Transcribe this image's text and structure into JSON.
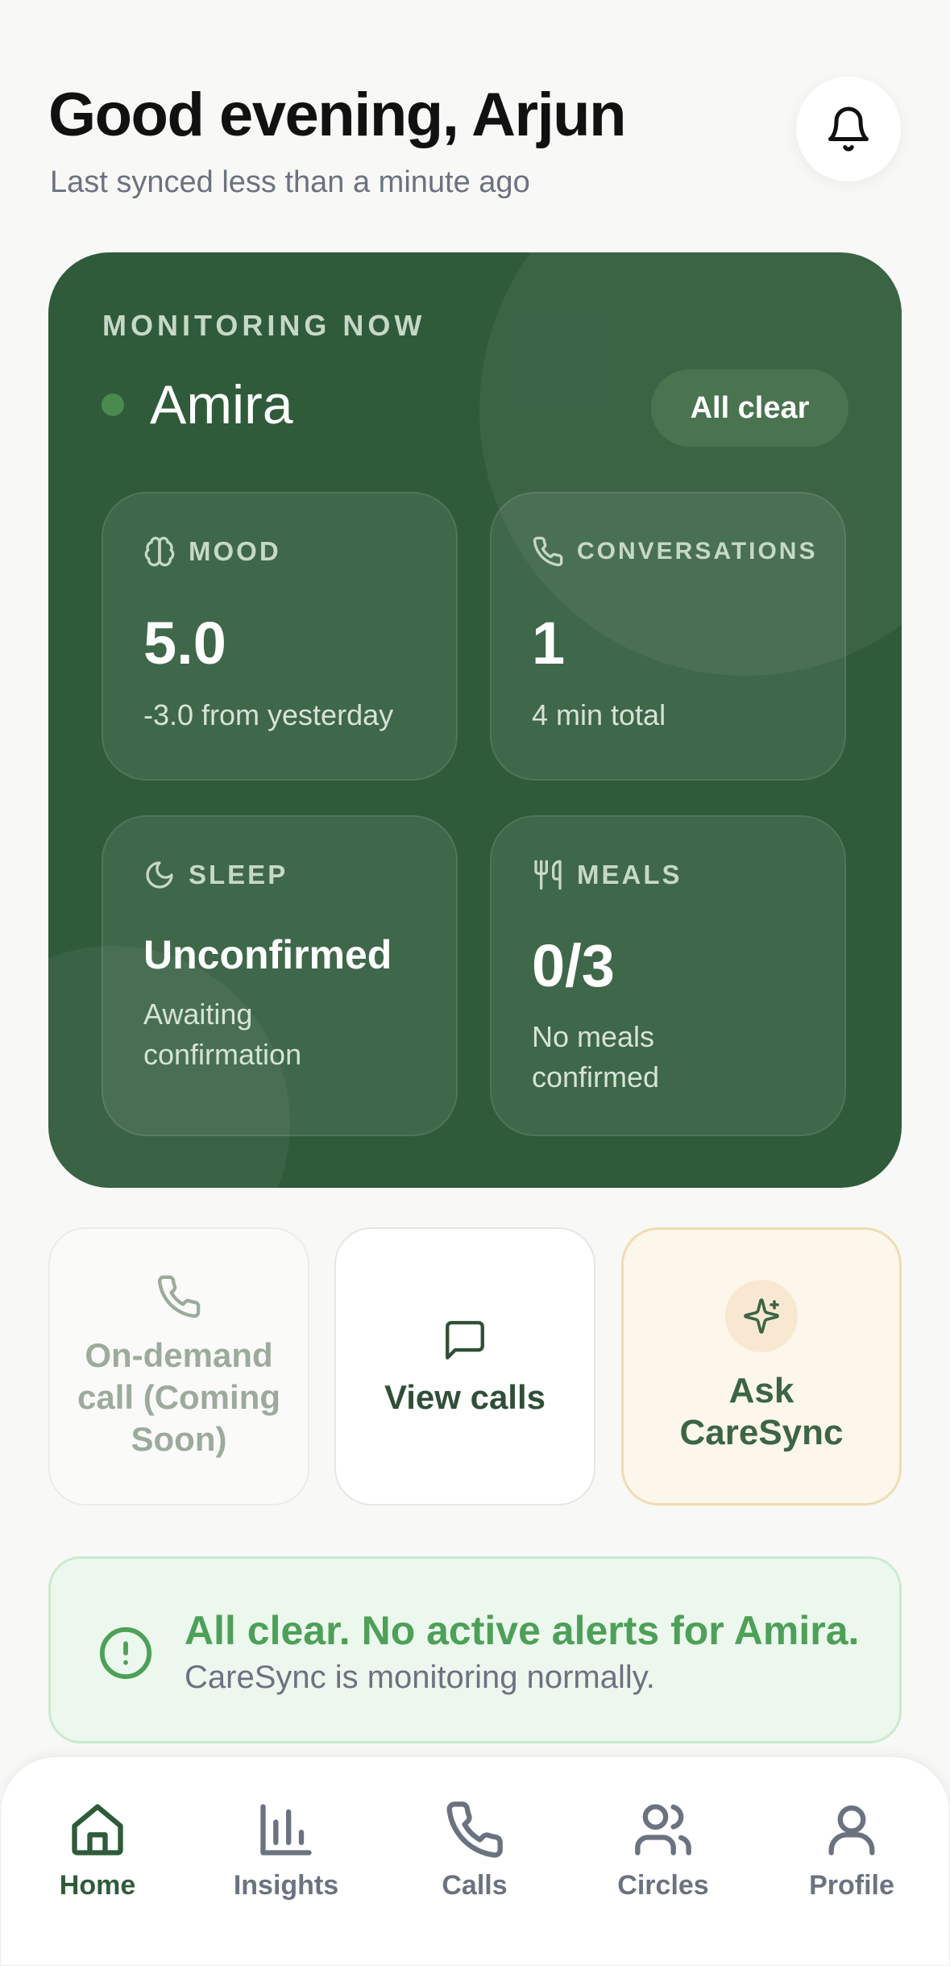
{
  "header": {
    "greeting": "Good evening, Arjun",
    "sync_status": "Last synced less than a minute ago",
    "notifications_icon": "bell-icon"
  },
  "monitoring": {
    "label": "MONITORING NOW",
    "patient_name": "Amira",
    "status_pill": "All clear",
    "accent": "#2f5b3a",
    "tiles": [
      {
        "icon": "brain-icon",
        "label": "MOOD",
        "value": "5.0",
        "sub": "-3.0 from yesterday"
      },
      {
        "icon": "phone-icon",
        "label": "CONVERSATIONS",
        "value": "1",
        "sub": "4 min total"
      },
      {
        "icon": "moon-icon",
        "label": "SLEEP",
        "value": "Unconfirmed",
        "sub": "Awaiting confirmation"
      },
      {
        "icon": "utensils-icon",
        "label": "MEALS",
        "value": "0/3",
        "sub": "No meals confirmed"
      }
    ]
  },
  "actions": [
    {
      "icon": "phone-icon",
      "label": "On-demand call (Coming Soon)",
      "disabled": true
    },
    {
      "icon": "message-icon",
      "label": "View calls"
    },
    {
      "icon": "sparkle-icon",
      "label": "Ask CareSync"
    }
  ],
  "alert": {
    "icon": "alert-circle-icon",
    "title": "All clear. No active alerts for Amira.",
    "subtitle": "CareSync is monitoring normally."
  },
  "tabbar": {
    "tabs": [
      {
        "icon": "home-icon",
        "label": "Home",
        "active": true
      },
      {
        "icon": "bar-chart-icon",
        "label": "Insights"
      },
      {
        "icon": "phone-icon",
        "label": "Calls"
      },
      {
        "icon": "users-icon",
        "label": "Circles"
      },
      {
        "icon": "user-icon",
        "label": "Profile"
      }
    ]
  }
}
